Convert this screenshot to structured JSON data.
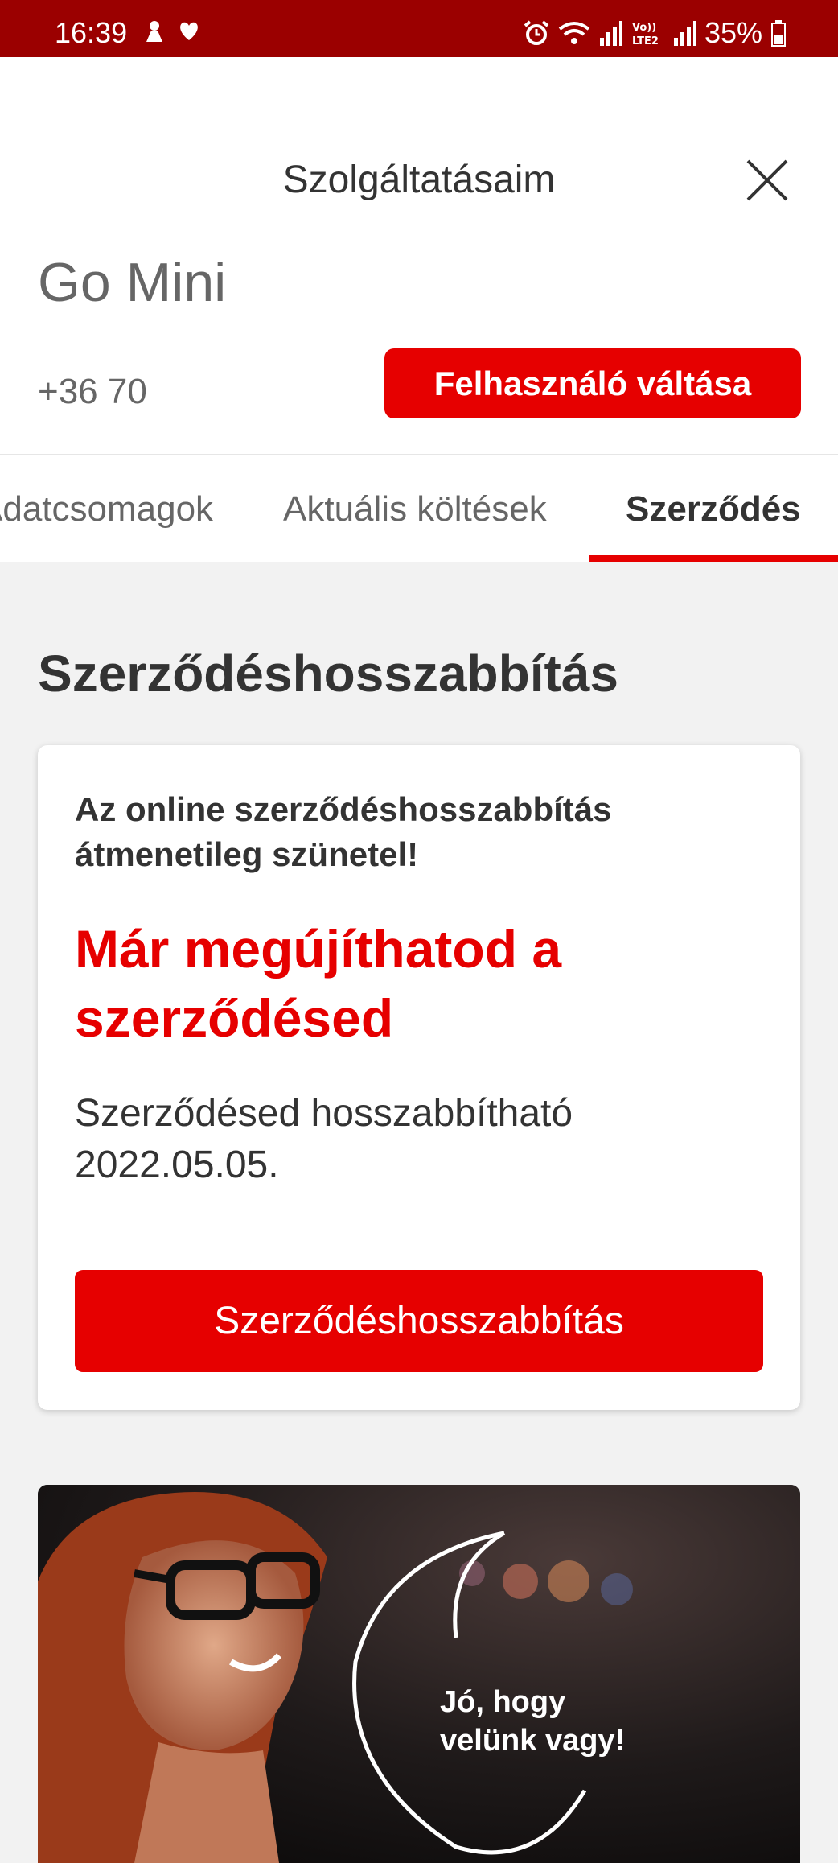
{
  "status_bar": {
    "time": "16:39",
    "battery_percent": "35%",
    "icons": [
      "bixby-icon",
      "heart-icon",
      "alarm-icon",
      "wifi-icon",
      "signal-icon",
      "volte-lte2-icon",
      "signal-icon",
      "battery-icon"
    ]
  },
  "header": {
    "title": "Szolgáltatásaim",
    "close_icon": "close-icon"
  },
  "account": {
    "plan_name": "Go Mini",
    "phone_number": "+36 70 ",
    "switch_user_label": "Felhasználó váltása"
  },
  "tabs": [
    {
      "label": "Adatcsomagok",
      "active": false
    },
    {
      "label": "Aktuális költések",
      "active": false
    },
    {
      "label": "Szerződés",
      "active": true
    }
  ],
  "section": {
    "title": "Szerződéshosszabbítás"
  },
  "card": {
    "notice": "Az online szerződéshosszabbítás átmenetileg szünetel!",
    "headline": "Már megújíthatod a szerződésed",
    "description": "Szerződésed hosszabbítható 2022.05.05.",
    "button_label": "Szerződéshosszabbítás"
  },
  "promo": {
    "text_line1": "Jó, hogy",
    "text_line2": "velünk vagy!"
  },
  "colors": {
    "accent": "#e60000",
    "status_bar": "#9b0000",
    "background": "#f2f2f2"
  }
}
